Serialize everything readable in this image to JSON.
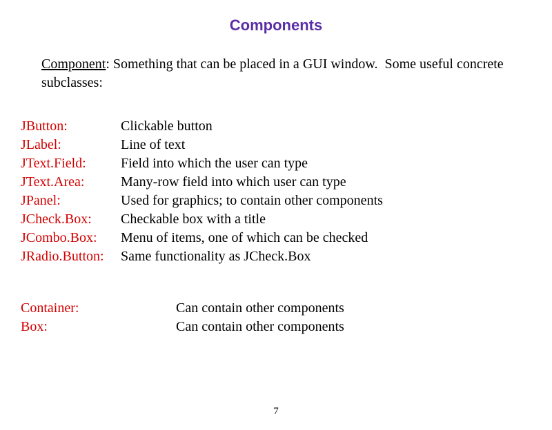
{
  "title": "Components",
  "intro": {
    "term": "Component",
    "definition": ": Something that can be placed in a GUI window.  Some useful concrete subclasses:"
  },
  "components": [
    {
      "name": "JButton:",
      "desc": "Clickable button"
    },
    {
      "name": "JLabel:",
      "desc": "Line of text"
    },
    {
      "name": "JText.Field:",
      "desc": "Field into which the user can type"
    },
    {
      "name": "JText.Area:",
      "desc": "Many-row field into which user can type"
    },
    {
      "name": "JPanel:",
      "desc": "Used for graphics; to contain other components"
    },
    {
      "name": "JCheck.Box:",
      "desc": "Checkable box with a title"
    },
    {
      "name": "JCombo.Box:",
      "desc": "Menu of items, one of which can be checked"
    },
    {
      "name": "JRadio.Button:",
      "desc": "Same functionality as JCheck.Box"
    }
  ],
  "containers": [
    {
      "name": "Container:",
      "desc": "Can contain other components"
    },
    {
      "name": "Box:",
      "desc": "Can contain other components"
    }
  ],
  "page_number": "7"
}
